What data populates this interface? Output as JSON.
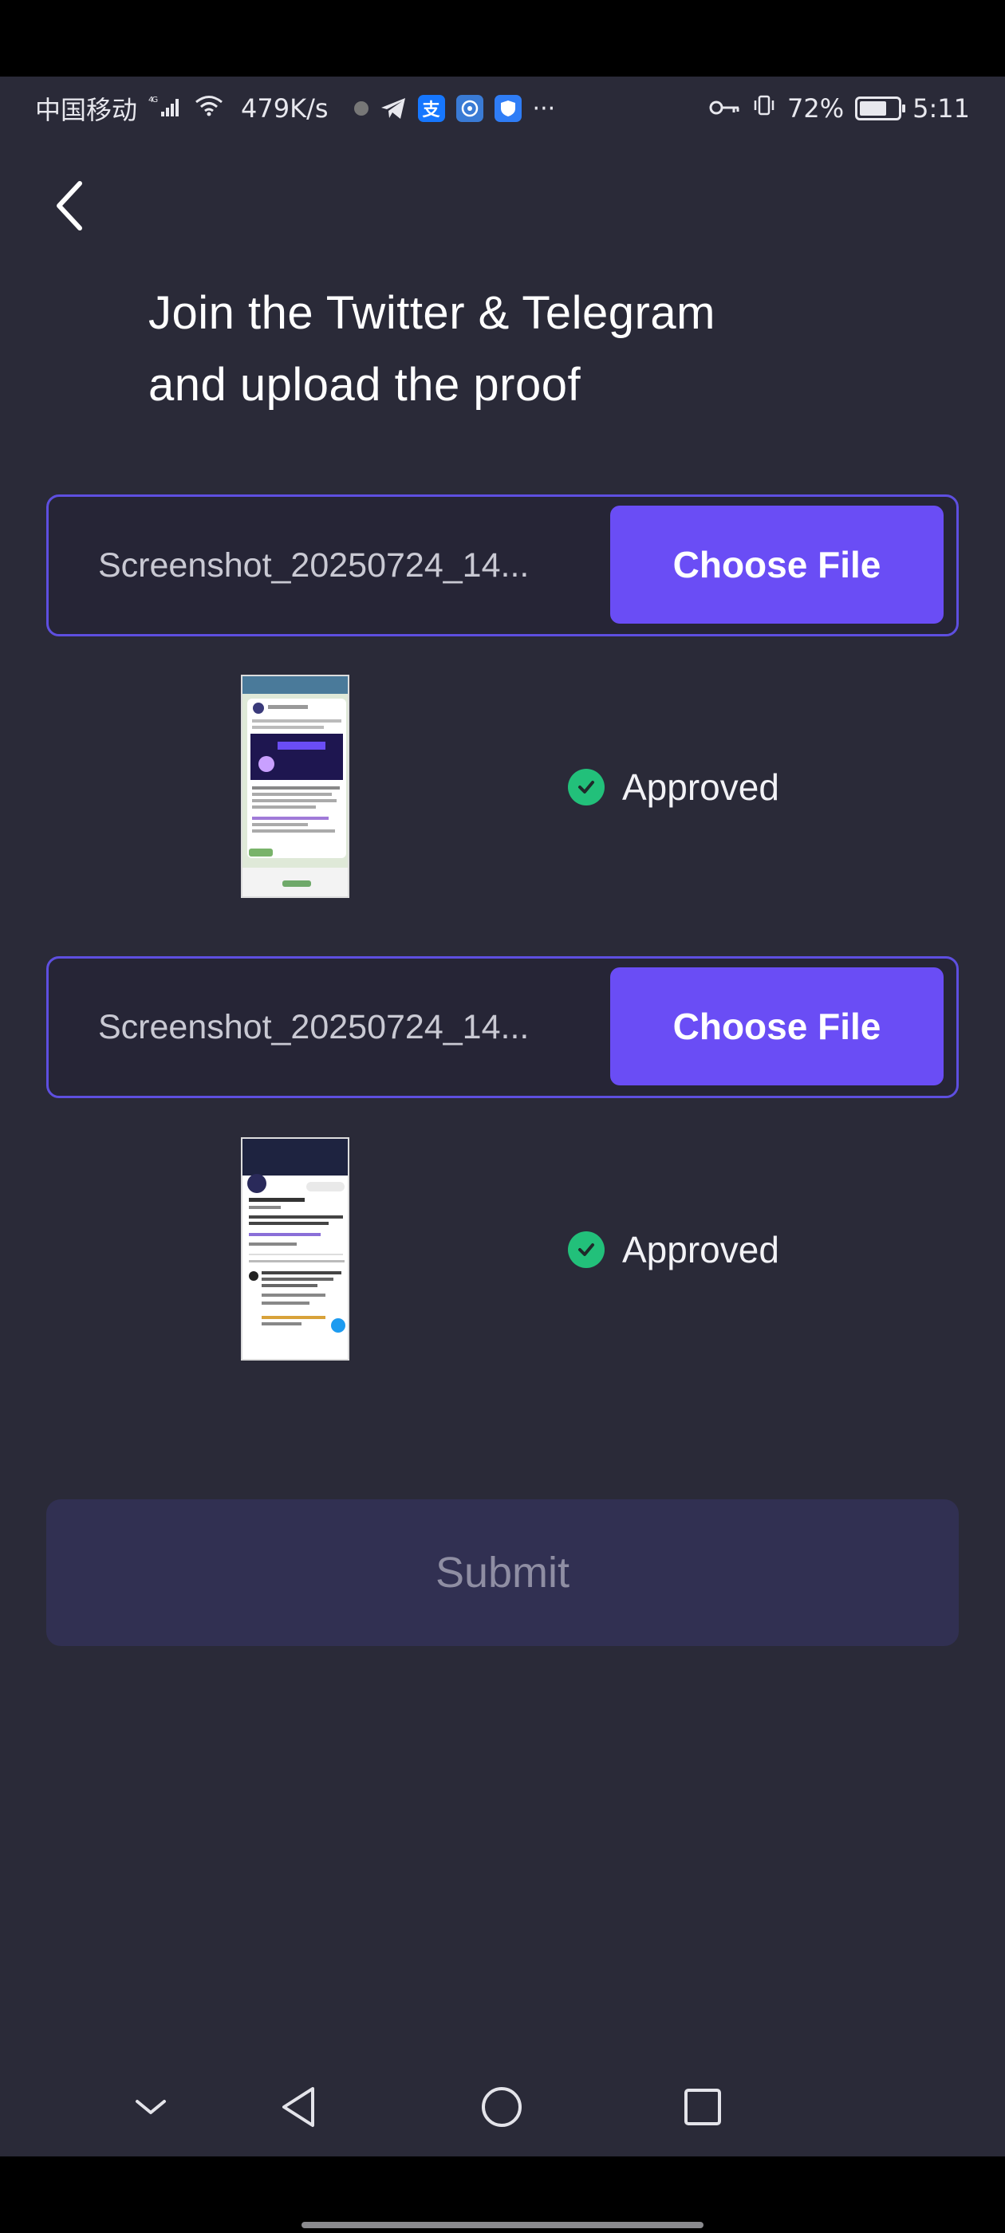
{
  "status_bar": {
    "carrier": "中国移动",
    "network": "4G",
    "speed": "479K/s",
    "icons": [
      "telegram-icon",
      "alipay-icon",
      "browser-icon",
      "shield-icon"
    ],
    "more": "···",
    "battery_pct": "72%",
    "battery_level": 0.72,
    "time": "5:11"
  },
  "header": {
    "back_icon": "chevron-left-icon",
    "title_line1": "Join the Twitter & Telegram",
    "title_line2": "and upload the proof"
  },
  "uploads": [
    {
      "filename": "Screenshot_20250724_14...",
      "button_label": "Choose File",
      "status": "Approved",
      "thumbnail": "telegram-screenshot"
    },
    {
      "filename": "Screenshot_20250724_14...",
      "button_label": "Choose File",
      "status": "Approved",
      "thumbnail": "twitter-screenshot"
    }
  ],
  "submit": {
    "label": "Submit"
  },
  "nav_bar": {
    "icons": [
      "collapse-icon",
      "back-triangle-icon",
      "home-circle-icon",
      "recents-square-icon"
    ]
  },
  "colors": {
    "background": "#2a2a38",
    "accent": "#6a4df5",
    "border": "#5e4fe0",
    "approved": "#22c07a",
    "submit_bg": "#313052"
  }
}
